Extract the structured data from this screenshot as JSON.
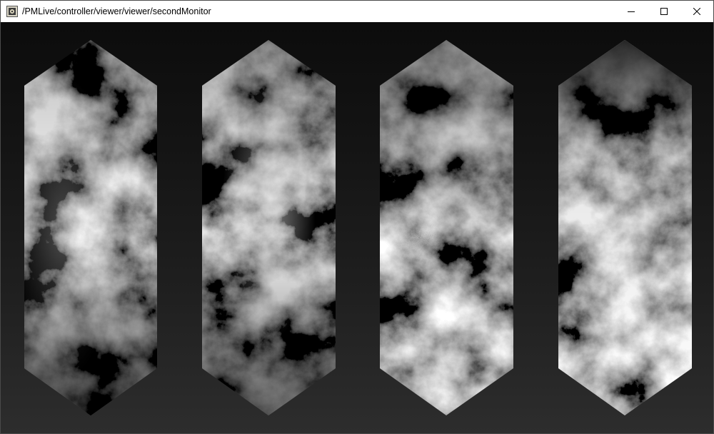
{
  "window": {
    "title": "/PMLive/controller/viewer/viewer/secondMonitor",
    "icon": "pmlive-app-icon"
  },
  "controls": {
    "minimize_icon": "minimize-icon",
    "maximize_icon": "maximize-icon",
    "close_icon": "close-icon"
  },
  "viewport": {
    "panel_count": 4,
    "panel_shape": "elongated hexagon",
    "texture": "grayscale cloud noise"
  },
  "colors": {
    "titlebar": "#ffffff",
    "viewport_top": "#0c0c0c",
    "viewport_bottom": "#2d2d2d"
  }
}
